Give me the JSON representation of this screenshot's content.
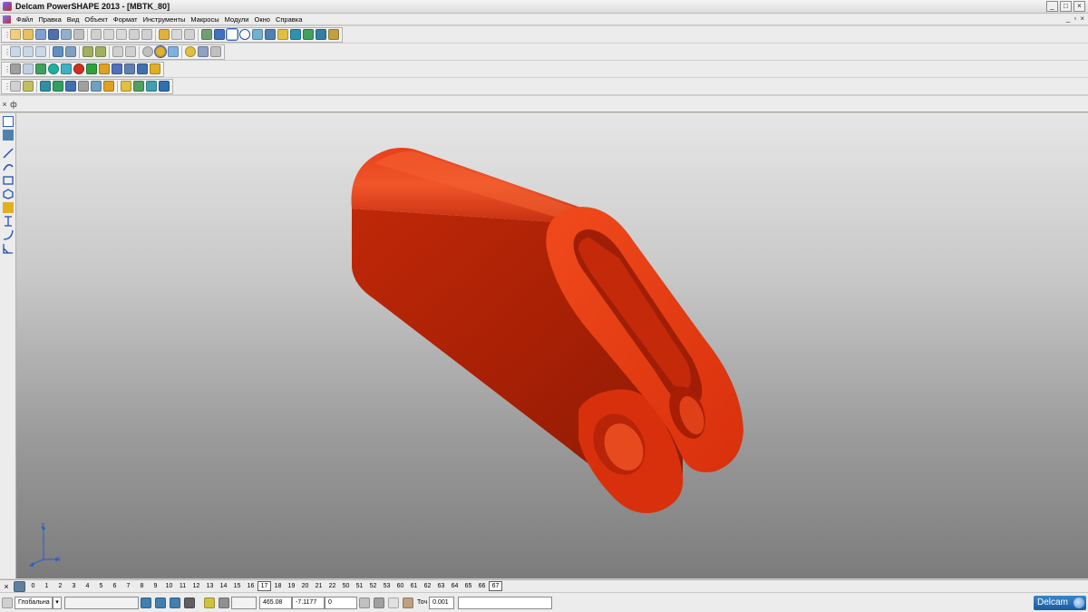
{
  "window": {
    "title": "Delcam PowerSHAPE 2013 - [MBTK_80]",
    "controls": {
      "minimize": "_",
      "maximize": "□",
      "close": "×"
    }
  },
  "menu": {
    "items": [
      "Файл",
      "Правка",
      "Вид",
      "Объект",
      "Формат",
      "Инструменты",
      "Макросы",
      "Модули",
      "Окно",
      "Справка"
    ],
    "mdi_controls": {
      "minimize": "_",
      "restore": "▫",
      "close": "×"
    }
  },
  "toolbars": {
    "close_glyph": "×",
    "pin_glyph": "ф"
  },
  "levels": {
    "items": [
      "0",
      "1",
      "2",
      "3",
      "4",
      "5",
      "6",
      "7",
      "8",
      "9",
      "10",
      "11",
      "12",
      "13",
      "14",
      "15",
      "16",
      "17",
      "18",
      "19",
      "20",
      "21",
      "22",
      "50",
      "51",
      "52",
      "53",
      "60",
      "61",
      "62",
      "63",
      "64",
      "65",
      "66",
      "67"
    ],
    "boxed": [
      "17",
      "67"
    ]
  },
  "status": {
    "workplane": "Глобальна",
    "x_coord": "465.08",
    "y_coord": "-7.1177",
    "z_coord": "0",
    "tolerance_label": "Точ",
    "tolerance_value": "0.001",
    "logo": "Delcam"
  },
  "model": {
    "color": "#d52a0c"
  },
  "axis_labels": {
    "z": "Z",
    "x": "X"
  }
}
